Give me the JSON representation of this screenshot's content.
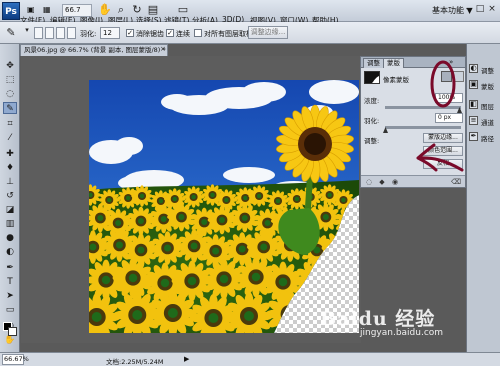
{
  "menubar": {
    "logo": "Ps",
    "zoom": "66.7",
    "items": [
      "文件(F)",
      "编辑(E)",
      "图像(I)",
      "图层(L)",
      "选择(S)",
      "滤镜(T)",
      "分析(A)",
      "3D(D)",
      "视图(V)",
      "窗口(W)",
      "帮助(H)"
    ],
    "workspace": "基本功能 ▼",
    "window_buttons": [
      "–",
      "□",
      "×"
    ],
    "toolbar_icons": [
      "hand-icon",
      "zoom-tool-icon",
      "rotate-icon",
      "arrange-icon",
      "screen-mode-icon"
    ]
  },
  "options": {
    "feather_label": "羽化:",
    "feather_value": "12",
    "antialias_label": "消除锯齿",
    "antialias_checked": "✓",
    "contiguous_label": "连续",
    "contiguous_checked": "✓",
    "sample_all_label": "对所有图层取样",
    "refine_label": "调整边缘..."
  },
  "document": {
    "tab_title": "风景06.jpg @ 66.7% (背景 副本, 图层蒙版/8) *",
    "close": "×"
  },
  "panel": {
    "tabs": [
      "调整",
      "蒙版"
    ],
    "collapse": "»",
    "mask_title": "像素蒙版",
    "density_label": "浓度:",
    "density_value": "100%",
    "feather_label": "羽化:",
    "feather_value": "0 px",
    "refine_label": "调整:",
    "edge_btn": "蒙版边缘...",
    "color_range_btn": "颜色范围...",
    "invert_btn": "反相"
  },
  "dock": {
    "items": [
      {
        "label": "调整",
        "icon": "adjust-icon"
      },
      {
        "label": "蒙版",
        "icon": "mask-icon"
      },
      {
        "label": "图层",
        "icon": "layers-icon"
      },
      {
        "label": "通道",
        "icon": "channels-icon"
      },
      {
        "label": "路径",
        "icon": "paths-icon"
      }
    ]
  },
  "status": {
    "zoom": "66.67%",
    "doc_size": "文档:2.25M/5.24M",
    "arrow": "▶"
  },
  "watermark": {
    "brand": "Baidu 经验",
    "url": "jingyan.baidu.com"
  },
  "colors": {
    "annotation": "#7a0a2a",
    "sky_top": "#1a4fb8",
    "sunflower": "#f5c400"
  }
}
